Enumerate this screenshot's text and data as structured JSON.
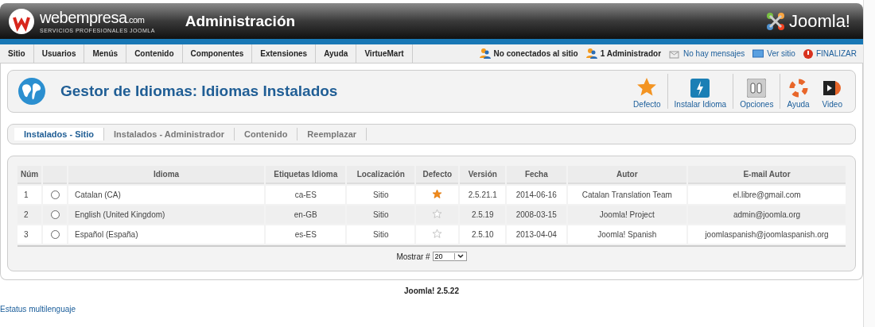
{
  "header": {
    "logo_text": "webempresa",
    "logo_suffix": ".com",
    "logo_tagline": "SERVICIOS PROFESIONALES JOOMLA",
    "title": "Administración",
    "brand": "Joomla!"
  },
  "menu": [
    {
      "label": "Sitio"
    },
    {
      "label": "Usuarios"
    },
    {
      "label": "Menús"
    },
    {
      "label": "Contenido"
    },
    {
      "label": "Componentes"
    },
    {
      "label": "Extensiones"
    },
    {
      "label": "Ayuda"
    },
    {
      "label": "VirtueMart"
    }
  ],
  "status": [
    {
      "kind": "users",
      "label": "No conectados al sitio"
    },
    {
      "kind": "admin",
      "label": "1 Administrador"
    },
    {
      "kind": "messages",
      "label": "No hay mensajes"
    },
    {
      "kind": "site",
      "label": "Ver sitio"
    },
    {
      "kind": "logout",
      "label": "FINALIZAR"
    }
  ],
  "page_title": "Gestor de Idiomas: Idiomas Instalados",
  "toolbar": [
    {
      "kind": "star",
      "label": "Defecto"
    },
    {
      "kind": "install",
      "label": "Instalar Idioma"
    },
    {
      "kind": "options",
      "label": "Opciones"
    },
    {
      "kind": "help",
      "label": "Ayuda"
    },
    {
      "kind": "video",
      "label": "Video"
    }
  ],
  "tabs": [
    {
      "label": "Instalados - Sitio",
      "selected": true
    },
    {
      "label": "Instalados - Administrador",
      "selected": false
    },
    {
      "label": "Contenido",
      "selected": false
    },
    {
      "label": "Reemplazar",
      "selected": false
    }
  ],
  "table": {
    "columns": [
      "Núm",
      "",
      "Idioma",
      "Etiquetas Idioma",
      "Localización",
      "Defecto",
      "Versión",
      "Fecha",
      "Autor",
      "E-mail Autor"
    ],
    "rows": [
      {
        "num": "1",
        "selected": false,
        "language": "Catalan (CA)",
        "tag": "ca-ES",
        "location": "Sitio",
        "default": true,
        "version": "2.5.21.1",
        "date": "2014-06-16",
        "author": "Catalan Translation Team",
        "email": "el.libre@gmail.com"
      },
      {
        "num": "2",
        "selected": false,
        "language": "English (United Kingdom)",
        "tag": "en-GB",
        "location": "Sitio",
        "default": false,
        "version": "2.5.19",
        "date": "2008-03-15",
        "author": "Joomla! Project",
        "email": "admin@joomla.org"
      },
      {
        "num": "3",
        "selected": false,
        "language": "Español (España)",
        "tag": "es-ES",
        "location": "Sitio",
        "default": false,
        "version": "2.5.10",
        "date": "2013-04-04",
        "author": "Joomla! Spanish",
        "email": "joomlaspanish@joomlaspanish.org"
      }
    ],
    "limit_label": "Mostrar #",
    "limit_value": "20"
  },
  "footer": {
    "version": "Joomla! 2.5.22",
    "link": "Estatus multilenguaje"
  }
}
